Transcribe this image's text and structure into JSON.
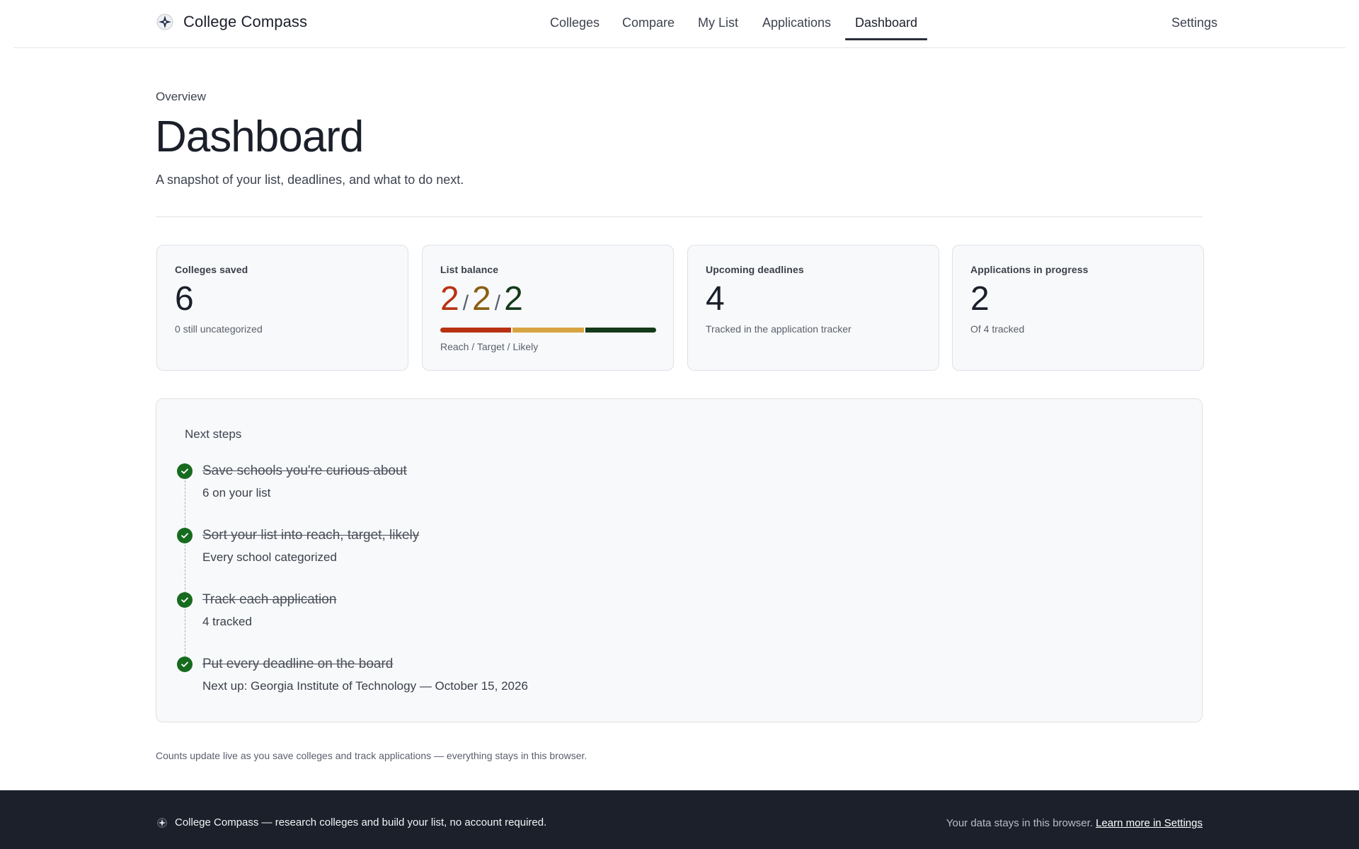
{
  "app": {
    "name": "College Compass"
  },
  "nav": {
    "items": [
      {
        "label": "Colleges"
      },
      {
        "label": "Compare"
      },
      {
        "label": "My List"
      },
      {
        "label": "Applications"
      },
      {
        "label": "Dashboard"
      }
    ],
    "active": "Dashboard",
    "settings_label": "Settings"
  },
  "page": {
    "eyebrow": "Overview",
    "title": "Dashboard",
    "subtitle": "A snapshot of your list, deadlines, and what to do next."
  },
  "stats": {
    "saved": {
      "label": "Colleges saved",
      "value": "6",
      "note": "0 still uncategorized"
    },
    "balance": {
      "label": "List balance",
      "reach": "2",
      "target": "2",
      "likely": "2",
      "sep": "/",
      "caption": "Reach / Target / Likely",
      "colors": {
        "reach": "#b83212",
        "target": "#d8a341",
        "likely": "#143a1a"
      }
    },
    "deadlines": {
      "label": "Upcoming deadlines",
      "value": "4",
      "note": "Tracked in the application tracker"
    },
    "applications": {
      "label": "Applications in progress",
      "value": "2",
      "note": "Of 4 tracked"
    }
  },
  "next_steps": {
    "title": "Next steps",
    "items": [
      {
        "title": "Save schools you're curious about",
        "detail": "6 on your list",
        "done": true
      },
      {
        "title": "Sort your list into reach, target, likely",
        "detail": "Every school categorized",
        "done": true
      },
      {
        "title": "Track each application",
        "detail": "4 tracked",
        "done": true
      },
      {
        "title": "Put every deadline on the board",
        "detail": "Next up: Georgia Institute of Technology — October 15, 2026",
        "done": true
      }
    ]
  },
  "footnote": "Counts update live as you save colleges and track applications — everything stays in this browser.",
  "footer": {
    "tagline": "College Compass — research colleges and build your list, no account required.",
    "privacy_text": "Your data stays in this browser.",
    "privacy_link": "Learn more in Settings"
  },
  "icons": {
    "brand": "compass-icon",
    "step_done": "check-icon"
  },
  "colors": {
    "accent_green": "#166b1e",
    "footer_bg": "#1b202b"
  }
}
